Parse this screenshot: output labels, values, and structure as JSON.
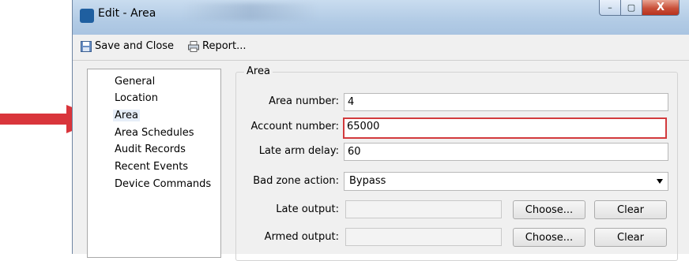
{
  "window": {
    "title": "Edit - Area",
    "controls": {
      "minimize": "–",
      "maximize": "▢",
      "close": "X"
    }
  },
  "toolbar": {
    "save_close_label": "Save and Close",
    "report_label": "Report..."
  },
  "nav": {
    "items": [
      {
        "label": "General"
      },
      {
        "label": "Location"
      },
      {
        "label": "Area"
      },
      {
        "label": "Area Schedules"
      },
      {
        "label": "Audit Records"
      },
      {
        "label": "Recent Events"
      },
      {
        "label": "Device Commands"
      }
    ],
    "selected": "Area"
  },
  "area": {
    "group_title": "Area",
    "area_number_label": "Area number:",
    "area_number_value": "4",
    "account_number_label": "Account number:",
    "account_number_value": "65000",
    "late_arm_delay_label": "Late arm delay:",
    "late_arm_delay_value": "60",
    "bad_zone_action_label": "Bad zone action:",
    "bad_zone_action_value": "Bypass",
    "late_output_label": "Late output:",
    "late_output_value": "",
    "armed_output_label": "Armed output:",
    "armed_output_value": "",
    "choose_label": "Choose...",
    "clear_label": "Clear"
  },
  "colors": {
    "highlight_border": "#d23a3d",
    "arrow": "#d9353b"
  },
  "icons": {
    "app": "app-icon",
    "save": "save-icon",
    "report": "printer-icon",
    "dropdown": "chevron-down-icon",
    "annotation": "arrow-right-icon"
  }
}
